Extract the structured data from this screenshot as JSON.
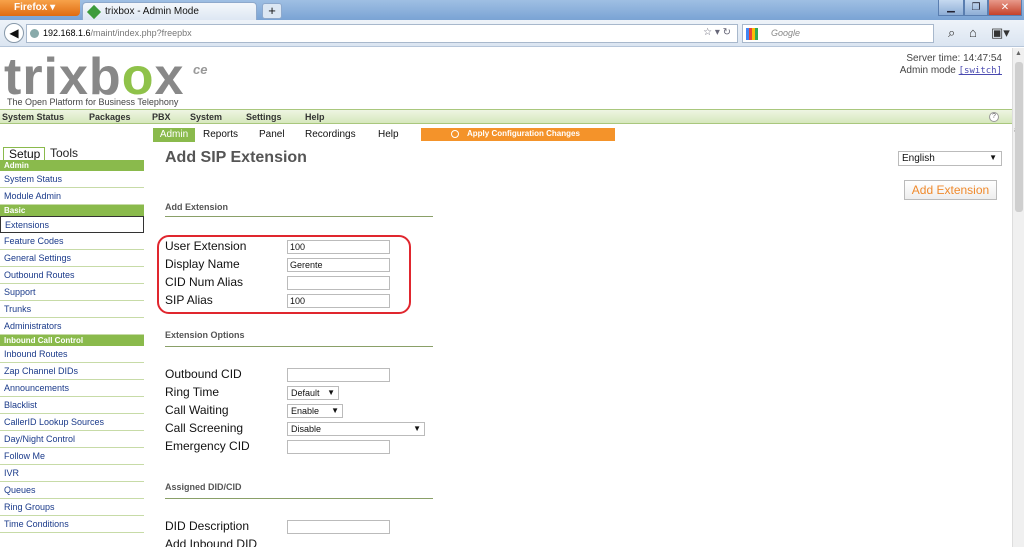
{
  "browser": {
    "menu_button": "Firefox",
    "tab_title": "trixbox - Admin Mode",
    "new_tab": "+",
    "url_host": "192.168.1.6",
    "url_path": "/maint/index.php?freepbx",
    "search_placeholder": "Google"
  },
  "header": {
    "logo_left": "trixb",
    "logo_o": "o",
    "logo_x": "x",
    "logo_suffix": "ce",
    "tagline": "The Open Platform for Business Telephony",
    "server_time": "Server time: 14:47:54",
    "admin_mode": "Admin mode",
    "switch": "[switch]"
  },
  "top_menu": {
    "items": [
      "System Status",
      "Packages",
      "PBX",
      "System",
      "Settings",
      "Help"
    ],
    "help_icon": "?"
  },
  "sub_tabs": [
    "Admin",
    "Reports",
    "Panel",
    "Recordings",
    "Help"
  ],
  "apply_button": "Apply Configuration Changes",
  "sidebar": {
    "tab_setup": "Setup",
    "tab_tools": "Tools",
    "sections": [
      {
        "title": "Admin",
        "items": [
          "System Status",
          "Module Admin"
        ]
      },
      {
        "title": "Basic",
        "items": [
          "Extensions",
          "Feature Codes",
          "General Settings",
          "Outbound Routes",
          "Support",
          "Trunks",
          "Administrators"
        ]
      },
      {
        "title": "Inbound Call Control",
        "items": [
          "Inbound Routes",
          "Zap Channel DIDs",
          "Announcements",
          "Blacklist",
          "CallerID Lookup Sources",
          "Day/Night Control",
          "Follow Me",
          "IVR",
          "Queues",
          "Ring Groups",
          "Time Conditions"
        ]
      }
    ],
    "selected": "Extensions"
  },
  "main": {
    "title": "Add SIP Extension",
    "language": "English",
    "add_extension_button": "Add Extension",
    "section_add": "Add Extension",
    "user_extension_label": "User Extension",
    "user_extension_value": "100",
    "display_name_label": "Display Name",
    "display_name_value": "Gerente",
    "cid_num_alias_label": "CID Num Alias",
    "cid_num_alias_value": "",
    "sip_alias_label": "SIP Alias",
    "sip_alias_value": "100",
    "section_options": "Extension Options",
    "outbound_cid_label": "Outbound CID",
    "outbound_cid_value": "",
    "ring_time_label": "Ring Time",
    "ring_time_value": "Default",
    "call_waiting_label": "Call Waiting",
    "call_waiting_value": "Enable",
    "call_screening_label": "Call Screening",
    "call_screening_value": "Disable",
    "emergency_cid_label": "Emergency CID",
    "emergency_cid_value": "",
    "section_did": "Assigned DID/CID",
    "did_description_label": "DID Description",
    "did_description_value": "",
    "add_inbound_did_label": "Add Inbound DID"
  },
  "colors": {
    "accent_green": "#8aba4c",
    "apply_orange": "#f4932a",
    "highlight_red": "#e0262e"
  }
}
